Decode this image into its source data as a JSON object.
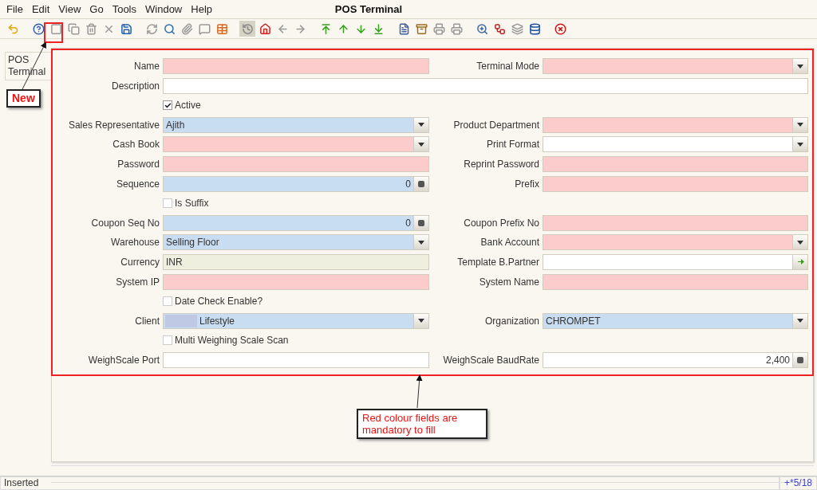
{
  "window": {
    "title": "POS Terminal"
  },
  "menu": [
    "File",
    "Edit",
    "View",
    "Go",
    "Tools",
    "Window",
    "Help"
  ],
  "sidebar": {
    "tabs": [
      {
        "label": "POS Terminal",
        "selected": true
      }
    ]
  },
  "form": {
    "rows": [
      {
        "kind": "pair",
        "fields": [
          {
            "label": "Name",
            "kind": "text",
            "color": "#fccccc"
          },
          {
            "label": "Terminal Mode",
            "kind": "combo",
            "color": "#fccccc"
          }
        ]
      },
      {
        "kind": "wide",
        "fields": [
          {
            "label": "Description",
            "kind": "text",
            "color": "#ffffff"
          }
        ]
      },
      {
        "kind": "checkbox",
        "label": "Active",
        "checked": true
      },
      {
        "kind": "pair",
        "fields": [
          {
            "label": "Sales Representative",
            "kind": "combo",
            "color": "#c9ddf2",
            "value": "Ajith"
          },
          {
            "label": "Product Department",
            "kind": "combo",
            "color": "#fccccc"
          }
        ]
      },
      {
        "kind": "pair",
        "fields": [
          {
            "label": "Cash Book",
            "kind": "combo",
            "color": "#fccccc"
          },
          {
            "label": "Print Format",
            "kind": "combo",
            "color": "#ffffff"
          }
        ]
      },
      {
        "kind": "pair",
        "fields": [
          {
            "label": "Password",
            "kind": "text",
            "color": "#fccccc"
          },
          {
            "label": "Reprint Password",
            "kind": "text",
            "color": "#fccccc"
          }
        ]
      },
      {
        "kind": "pair",
        "fields": [
          {
            "label": "Sequence",
            "kind": "number",
            "color": "#c9ddf2",
            "value": "0"
          },
          {
            "label": "Prefix",
            "kind": "text",
            "color": "#fccccc"
          }
        ]
      },
      {
        "kind": "checkbox",
        "label": "Is Suffix",
        "checked": false
      },
      {
        "kind": "pair",
        "fields": [
          {
            "label": "Coupon Seq No",
            "kind": "number",
            "color": "#c9ddf2",
            "value": "0"
          },
          {
            "label": "Coupon Prefix No",
            "kind": "text",
            "color": "#fccccc"
          }
        ]
      },
      {
        "kind": "pair",
        "fields": [
          {
            "label": "Warehouse",
            "kind": "combo",
            "color": "#c9ddf2",
            "value": "Selling Floor"
          },
          {
            "label": "Bank Account",
            "kind": "combo",
            "color": "#fccccc"
          }
        ]
      },
      {
        "kind": "pair",
        "fields": [
          {
            "label": "Currency",
            "kind": "text",
            "color": "#efefe0",
            "value": "INR"
          },
          {
            "label": "Template B.Partner",
            "kind": "search",
            "color": "#ffffff"
          }
        ]
      },
      {
        "kind": "pair",
        "fields": [
          {
            "label": "System IP",
            "kind": "text",
            "color": "#fccccc"
          },
          {
            "label": "System Name",
            "kind": "text",
            "color": "#fccccc"
          }
        ]
      },
      {
        "kind": "checkbox",
        "label": "Date Check Enable?",
        "checked": false
      },
      {
        "kind": "pair",
        "fields": [
          {
            "label": "Client",
            "kind": "combo",
            "color": "#c9ddf2",
            "value": "Lifestyle",
            "logo": true
          },
          {
            "label": "Organization",
            "kind": "combo",
            "color": "#c9ddf2",
            "value": "CHROMPET"
          }
        ]
      },
      {
        "kind": "checkbox",
        "label": "Multi Weighing Scale Scan",
        "checked": false
      },
      {
        "kind": "pair",
        "fields": [
          {
            "label": "WeighScale Port",
            "kind": "text",
            "color": "#ffffff"
          },
          {
            "label": "WeighScale BaudRate",
            "kind": "number",
            "color": "#ffffff",
            "value": "2,400"
          }
        ]
      }
    ]
  },
  "annotations": [
    {
      "kind": "toolbar",
      "text": "New"
    },
    {
      "kind": "form",
      "text": "Red colour fields are mandatory to fill"
    }
  ],
  "status_bar": {
    "message": "Inserted",
    "record": "+*5/18"
  }
}
